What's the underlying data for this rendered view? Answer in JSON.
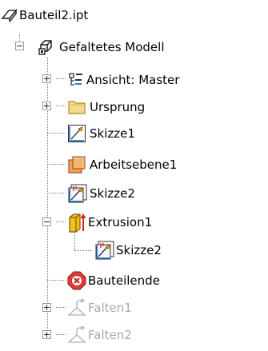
{
  "root": {
    "label": "Bauteil2.ipt",
    "icon": "part-file-icon"
  },
  "model": {
    "label": "Gefaltetes Modell",
    "icon": "folded-model-icon",
    "expanded": true
  },
  "items": [
    {
      "label": "Ansicht: Master",
      "icon": "view-representation-icon",
      "expandable": true,
      "expanded": false
    },
    {
      "label": "Ursprung",
      "icon": "folder-icon",
      "expandable": true,
      "expanded": false
    },
    {
      "label": "Skizze1",
      "icon": "sketch-icon",
      "expandable": false
    },
    {
      "label": "Arbeitsebene1",
      "icon": "work-plane-icon",
      "expandable": false
    },
    {
      "label": "Skizze2",
      "icon": "shared-sketch-icon",
      "expandable": false
    },
    {
      "label": "Extrusion1",
      "icon": "extrusion-icon",
      "expandable": true,
      "expanded": true
    },
    {
      "label": "Skizze2",
      "icon": "consumed-sketch-icon",
      "child_of": "Extrusion1"
    },
    {
      "label": "Bauteilende",
      "icon": "end-of-part-icon",
      "expandable": false
    },
    {
      "label": "Falten1",
      "icon": "fold-icon",
      "expandable": true,
      "expanded": false,
      "suppressed": true
    },
    {
      "label": "Falten2",
      "icon": "fold-icon",
      "expandable": true,
      "expanded": false,
      "suppressed": true
    }
  ]
}
